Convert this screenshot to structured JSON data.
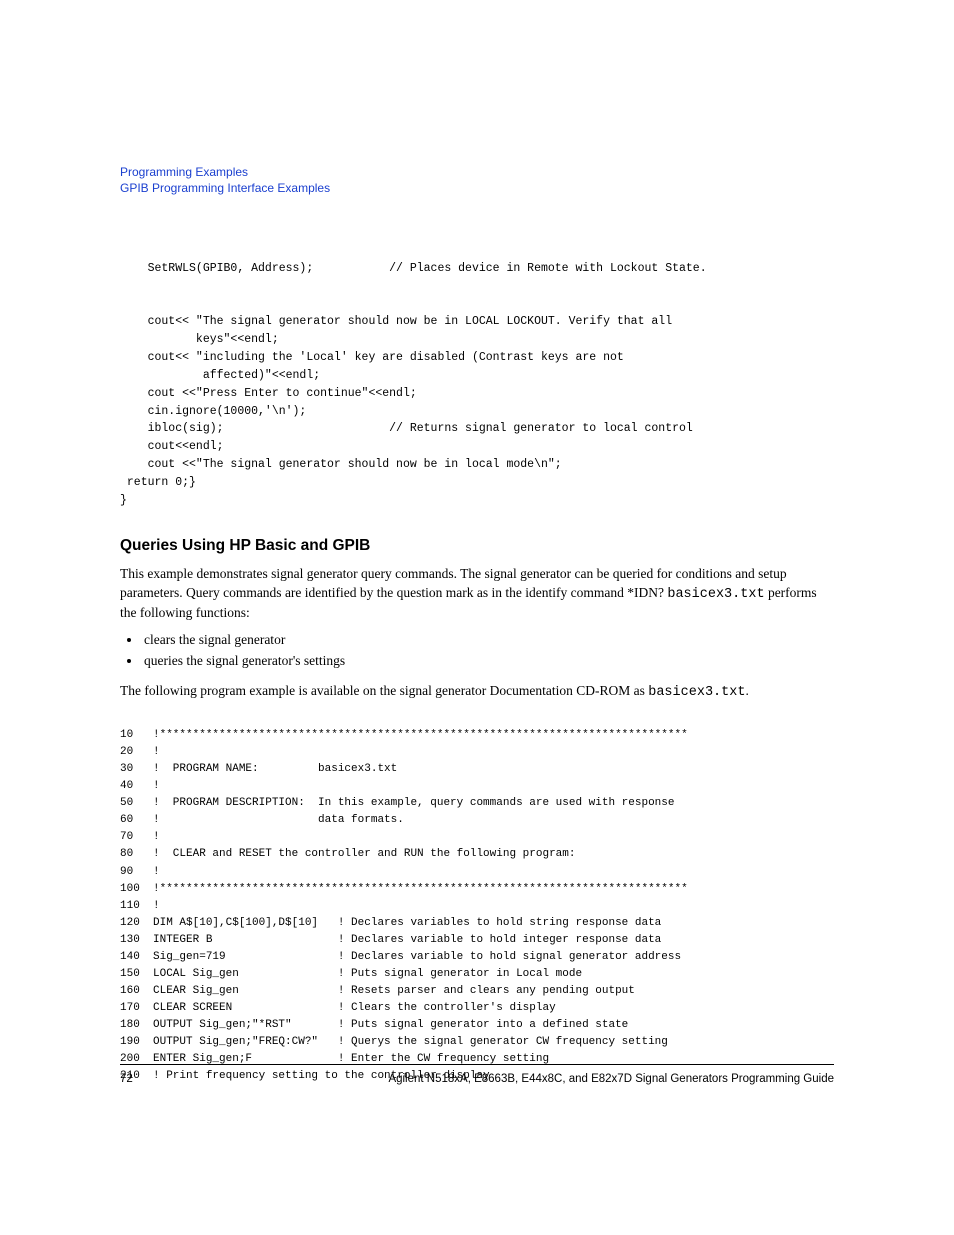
{
  "header": {
    "line1": "Programming Examples",
    "line2": "GPIB Programming Interface Examples"
  },
  "code1": {
    "l1": "    SetRWLS(GPIB0, Address);           // Places device in Remote with Lockout State.",
    "l2": "",
    "l3": "    cout<< \"The signal generator should now be in LOCAL LOCKOUT. Verify that all",
    "l4": "           keys\"<<endl;",
    "l5": "    cout<< \"including the 'Local' key are disabled (Contrast keys are not",
    "l6": "            affected)\"<<endl;",
    "l7": "    cout <<\"Press Enter to continue\"<<endl;",
    "l8": "    cin.ignore(10000,'\\n');",
    "l9": "    ibloc(sig);                        // Returns signal generator to local control",
    "l10": "    cout<<endl;",
    "l11": "    cout <<\"The signal generator should now be in local mode\\n\";",
    "l12": " return 0;}",
    "l13": "}"
  },
  "section": {
    "heading": "Queries Using HP Basic and GPIB",
    "p1_a": "This example demonstrates signal generator query commands. The signal generator can be queried for conditions and setup parameters. Query commands are identified by the question mark as in the identify command *IDN? ",
    "p1_b": "basicex3.txt",
    "p1_c": " performs the following functions:",
    "b1": "clears the signal generator",
    "b2": "queries the signal generator's settings",
    "p2_a": "The following program example is available on the signal generator Documentation CD-ROM as ",
    "p2_b": "basicex3.txt",
    "p2_c": "."
  },
  "listing": {
    "l10": "10   !********************************************************************************",
    "l20": "20   !",
    "l30": "30   !  PROGRAM NAME:         basicex3.txt",
    "l40": "40   !",
    "l50": "50   !  PROGRAM DESCRIPTION:  In this example, query commands are used with response",
    "l60": "60   !                        data formats.",
    "l70": "70   !",
    "l80": "80   !  CLEAR and RESET the controller and RUN the following program:",
    "l90": "90   !",
    "l100": "100  !********************************************************************************",
    "l110": "110  !",
    "l120": "120  DIM A$[10],C$[100],D$[10]   ! Declares variables to hold string response data",
    "l130": "130  INTEGER B                   ! Declares variable to hold integer response data",
    "l140": "140  Sig_gen=719                 ! Declares variable to hold signal generator address",
    "l150": "150  LOCAL Sig_gen               ! Puts signal generator in Local mode",
    "l160": "160  CLEAR Sig_gen               ! Resets parser and clears any pending output",
    "l170": "170  CLEAR SCREEN                ! Clears the controller's display",
    "l180": "180  OUTPUT Sig_gen;\"*RST\"       ! Puts signal generator into a defined state",
    "l190": "190  OUTPUT Sig_gen;\"FREQ:CW?\"   ! Querys the signal generator CW frequency setting",
    "l200": "200  ENTER Sig_gen;F             ! Enter the CW frequency setting",
    "l210": "210  ! Print frequency setting to the controller display"
  },
  "footer": {
    "page": "72",
    "title": "Agilent N518xA, E8663B, E44x8C, and E82x7D Signal Generators Programming Guide"
  }
}
